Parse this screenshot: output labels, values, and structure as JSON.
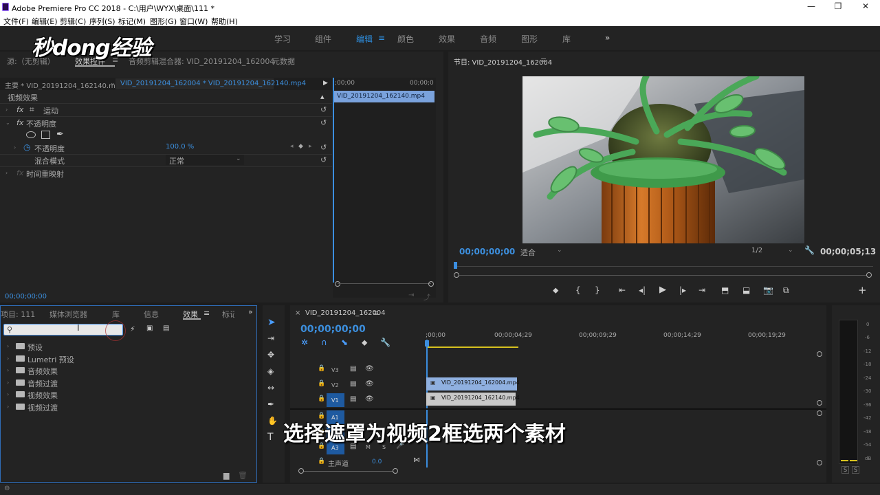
{
  "titlebar": {
    "title": "Adobe Premiere Pro CC 2018 - C:\\用户\\WYX\\桌面\\111 *",
    "min": "—",
    "max": "❐",
    "close": "✕"
  },
  "menu": [
    "文件(F)",
    "编辑(E)",
    "剪辑(C)",
    "序列(S)",
    "标记(M)",
    "图形(G)",
    "窗口(W)",
    "帮助(H)"
  ],
  "workspaces": {
    "items": [
      "学习",
      "组件",
      "编辑",
      "颜色",
      "效果",
      "音频",
      "图形",
      "库"
    ],
    "active": "编辑",
    "more": "»",
    "menu_glyph": "≡"
  },
  "watermark": "秒dong经验",
  "source_panel": {
    "tabs": [
      "源:（无剪辑）",
      "效果控件",
      "音频剪辑混合器: VID_20191204_162004",
      "元数据"
    ],
    "active_tab": "效果控件",
    "menu_glyph": "≡",
    "master_clip": "主要 * VID_20191204_162140.mp4",
    "sequence_clip": "VID_20191204_162004 * VID_20191204_162140.mp4",
    "ruler_start": ";00;00",
    "ruler_end": "00;00;0",
    "clip_bar": "VID_20191204_162140.mp4",
    "section_header": "视频效果",
    "effects": [
      {
        "name": "运动",
        "fx": "fx"
      },
      {
        "name": "不透明度",
        "fx": "fx"
      }
    ],
    "opacity_label": "不透明度",
    "opacity_value": "100.0 %",
    "blend_label": "混合模式",
    "blend_value": "正常",
    "time_remap": "时间重映射",
    "timecode": "00;00;00;00"
  },
  "program_panel": {
    "title": "节目: VID_20191204_162004",
    "menu_glyph": "≡",
    "timecode": "00;00;00;00",
    "fit": "适合",
    "resolution": "1/2",
    "duration": "00;00;05;13",
    "add_glyph": "+"
  },
  "project_panel": {
    "tabs": [
      "项目: 111",
      "媒体浏览器",
      "库",
      "信息",
      "效果",
      "标记"
    ],
    "active_tab": "效果",
    "menu_glyph": "≡",
    "more": "»",
    "search_placeholder": "",
    "tree": [
      "预设",
      "Lumetri 预设",
      "音频效果",
      "音频过渡",
      "视频效果",
      "视频过渡"
    ]
  },
  "timeline": {
    "sequence": "VID_20191204_162004",
    "menu_glyph": "≡",
    "timecode": "00;00;00;00",
    "ruler": [
      ";00;00",
      "00;00;04;29",
      "00;00;09;29",
      "00;00;14;29",
      "00;00;19;29"
    ],
    "tracks": [
      {
        "name": "V3"
      },
      {
        "name": "V2"
      },
      {
        "name": "V1"
      },
      {
        "name": "A1"
      },
      {
        "name": "A2"
      },
      {
        "name": "A3"
      }
    ],
    "clip_v2": "VID_20191204_162004.mp4",
    "clip_v1": "VID_20191204_162140.mp4",
    "master_label": "主声道",
    "master_value": "0.0",
    "mute": "M",
    "solo": "S"
  },
  "meter": {
    "labels": [
      "0",
      "-6",
      "-12",
      "-18",
      "-24",
      "-30",
      "-36",
      "-42",
      "-48",
      "-54",
      "dB"
    ],
    "solo_buttons": [
      "S",
      "S"
    ]
  },
  "subtitle": "选择遮罩为视频2框选两个素材"
}
